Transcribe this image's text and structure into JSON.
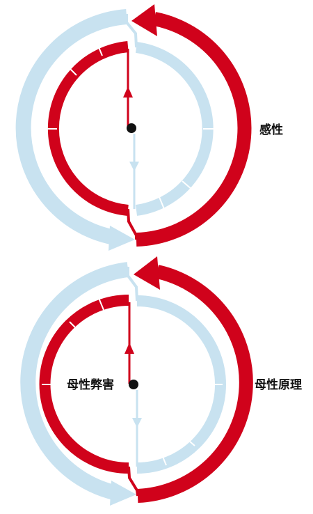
{
  "colors": {
    "red": "#d0021b",
    "blue": "#c8e2f0",
    "center_dot": "#111111",
    "background": "#ffffff"
  },
  "diagrams": [
    {
      "right_label": "感性",
      "left_label": ""
    },
    {
      "right_label": "母性原理",
      "left_label": "母性弊害"
    }
  ]
}
